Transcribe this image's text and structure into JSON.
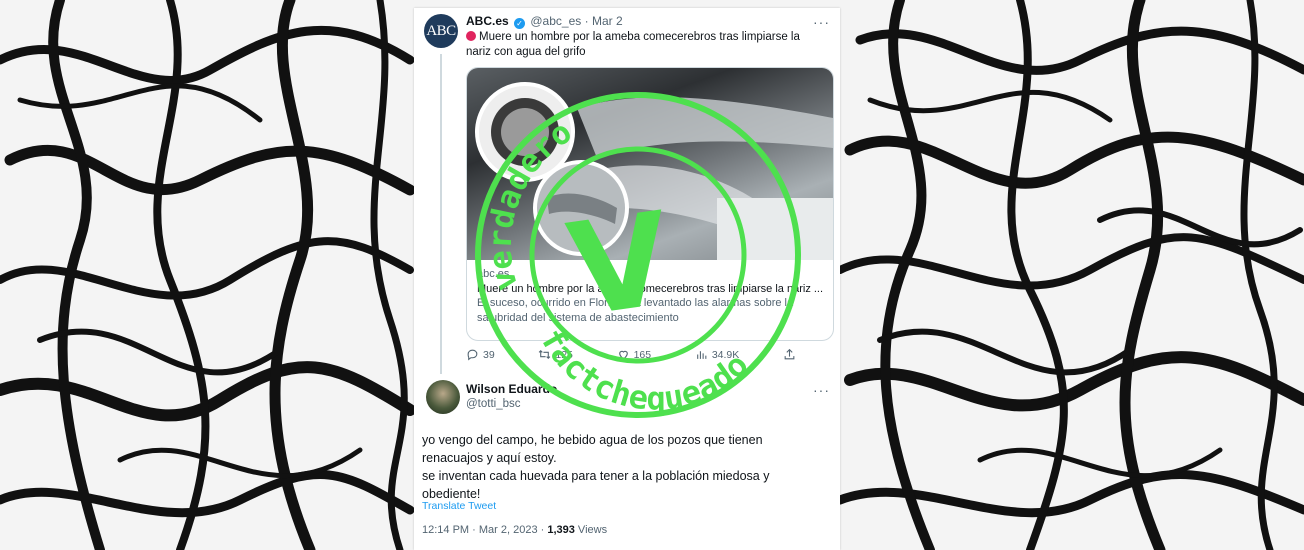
{
  "tweet": {
    "author_name": "ABC.es",
    "author_handle": "@abc_es",
    "date": "Mar 2",
    "avatar_text": "ABC",
    "text": "Muere un hombre por la ameba comecerebros tras limpiarse la nariz con agua del grifo",
    "link_domain": "abc.es",
    "link_title": "Muere un hombre por la ameba comecerebros tras limpiarse la nariz ...",
    "link_description": "El suceso, ocurrido en Florida, ha levantado las alarmas sobre la salubridad del sistema de abastecimiento",
    "actions": {
      "replies": "39",
      "retweets": "125",
      "likes": "165",
      "views": "34.9K"
    }
  },
  "reply": {
    "author_name": "Wilson Eduardo",
    "author_handle": "@totti_bsc",
    "text_lines": [
      "yo vengo del campo, he bebido agua de los pozos que tienen renacuajos y aquí estoy.",
      "se inventan cada huevada para tener a la población miedosa y obediente!"
    ],
    "translate_label": "Translate Tweet",
    "timestamp": "12:14 PM · Mar 2, 2023 · ",
    "views_count": "1,393",
    "views_label": " Views"
  },
  "stamp": {
    "top_text": "verdadero",
    "bottom_text": "factchequeado",
    "letter": "V",
    "color": "#4ee04e"
  },
  "icons": {
    "more": "more-icon",
    "verified": "verified-badge-icon",
    "reply": "reply-icon",
    "retweet": "retweet-icon",
    "like": "heart-icon",
    "views": "views-icon",
    "share": "share-icon"
  }
}
